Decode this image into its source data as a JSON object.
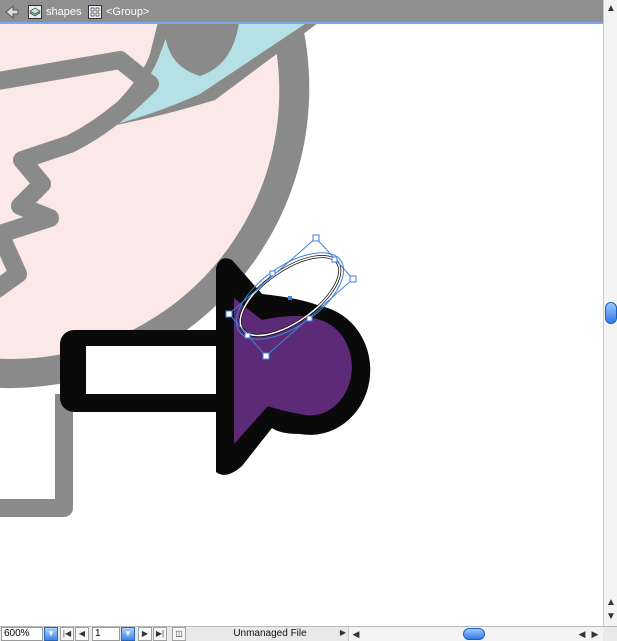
{
  "breadcrumb": {
    "layer_label": "shapes",
    "group_label": "<Group>"
  },
  "statusbar": {
    "zoom": "600%",
    "page": "1",
    "status": "Unmanaged File"
  },
  "colors": {
    "purple_fill": "#5d2a78",
    "black_stroke": "#0a0a0a",
    "gray_stroke": "#8a8a8a",
    "pink_fill": "#fbe9e8",
    "cyan_fill": "#b5e1e6",
    "selection_blue": "#3f82d8"
  },
  "icons": {
    "back": "back-arrow-icon",
    "layer": "layer-icon",
    "group": "group-icon"
  }
}
